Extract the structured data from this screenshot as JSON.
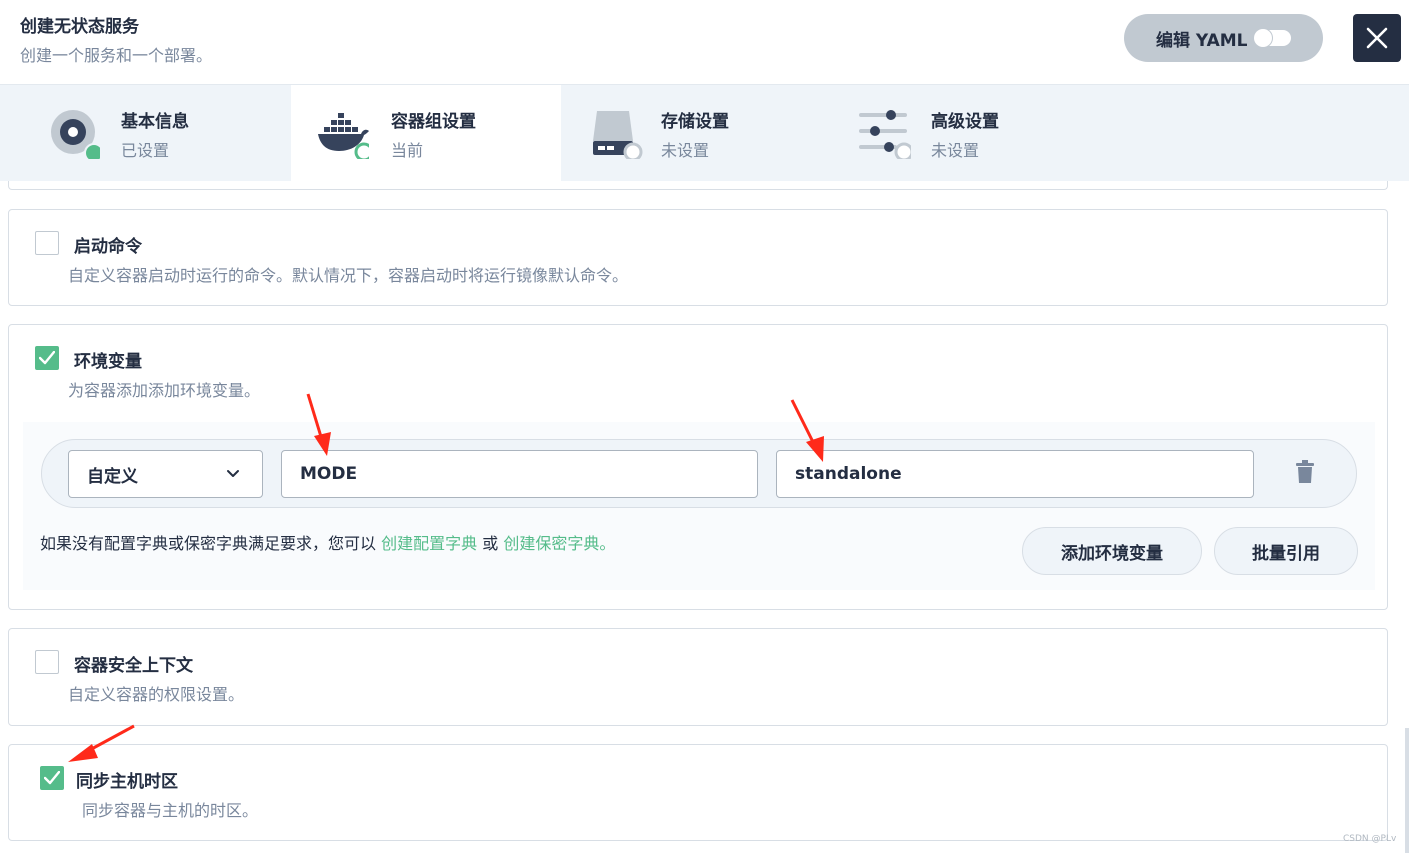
{
  "header": {
    "title": "创建无状态服务",
    "subtitle": "创建一个服务和一个部署。",
    "yaml_label": "编辑 YAML"
  },
  "steps": [
    {
      "title": "基本信息",
      "status": "已设置",
      "icon": "disc-icon"
    },
    {
      "title": "容器组设置",
      "status": "当前",
      "icon": "docker-icon"
    },
    {
      "title": "存储设置",
      "status": "未设置",
      "icon": "storage-icon"
    },
    {
      "title": "高级设置",
      "status": "未设置",
      "icon": "sliders-icon"
    }
  ],
  "cards": {
    "startup": {
      "title": "启动命令",
      "desc": "自定义容器启动时运行的命令。默认情况下，容器启动时将运行镜像默认命令。",
      "checked": false
    },
    "env": {
      "title": "环境变量",
      "desc": "为容器添加添加环境变量。",
      "checked": true,
      "row": {
        "type": "自定义",
        "key": "MODE",
        "value": "standalone"
      },
      "hint_prefix": "如果没有配置字典或保密字典满足要求，您可以",
      "link_configmap": "创建配置字典",
      "hint_or": "或",
      "link_secret": "创建保密字典。",
      "add_button": "添加环境变量",
      "batch_button": "批量引用"
    },
    "security": {
      "title": "容器安全上下文",
      "desc": "自定义容器的权限设置。",
      "checked": false
    },
    "timezone": {
      "title": "同步主机时区",
      "desc": "同步容器与主机的时区。",
      "checked": true
    }
  },
  "colors": {
    "accent": "#55bc8a",
    "dark": "#242e42",
    "muted": "#79879c",
    "annotation": "#ff2a1a"
  },
  "watermark": "CSDN @PLv"
}
